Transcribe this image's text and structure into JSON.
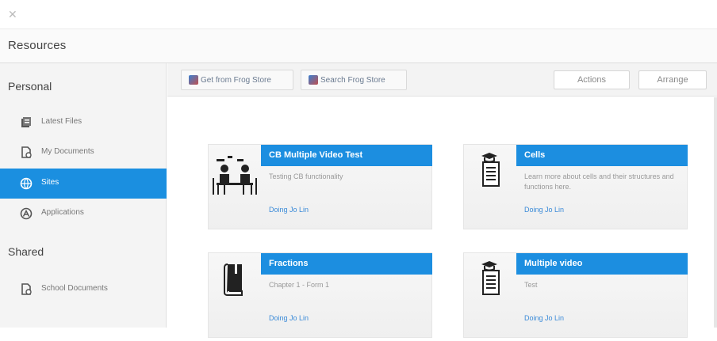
{
  "window": {
    "close_glyph": "✕"
  },
  "header": {
    "title": "Resources"
  },
  "sidebar": {
    "personal_heading": "Personal",
    "shared_heading": "Shared",
    "items": [
      {
        "label": "Latest Files",
        "icon": "files-icon"
      },
      {
        "label": "My Documents",
        "icon": "document-icon"
      },
      {
        "label": "Sites",
        "icon": "globe-icon",
        "active": true
      },
      {
        "label": "Applications",
        "icon": "applications-icon"
      }
    ],
    "shared_items": [
      {
        "label": "School Documents",
        "icon": "document-icon"
      }
    ]
  },
  "toolbar": {
    "tabs": [
      {
        "label": "Get from Frog Store"
      },
      {
        "label": "Search Frog Store"
      }
    ],
    "actions_label": "Actions",
    "arrange_label": "Arrange"
  },
  "cards": [
    {
      "title": "CB Multiple Video Test",
      "description": "Testing CB functionality",
      "link": "Doing Jo Lin",
      "thumb": "classroom-icon"
    },
    {
      "title": "Cells",
      "description": "Learn more about cells and their structures and functions here.",
      "link": "Doing Jo Lin",
      "thumb": "lesson-board-icon"
    },
    {
      "title": "Fractions",
      "description": "Chapter 1 - Form 1",
      "link": "Doing Jo Lin",
      "thumb": "book-icon"
    },
    {
      "title": "Multiple video",
      "description": "Test",
      "link": "Doing Jo Lin",
      "thumb": "lesson-board-icon"
    }
  ],
  "colors": {
    "accent": "#1c8ee0",
    "sidebar_bg": "#f4f4f4",
    "link": "#3a8ad8"
  }
}
